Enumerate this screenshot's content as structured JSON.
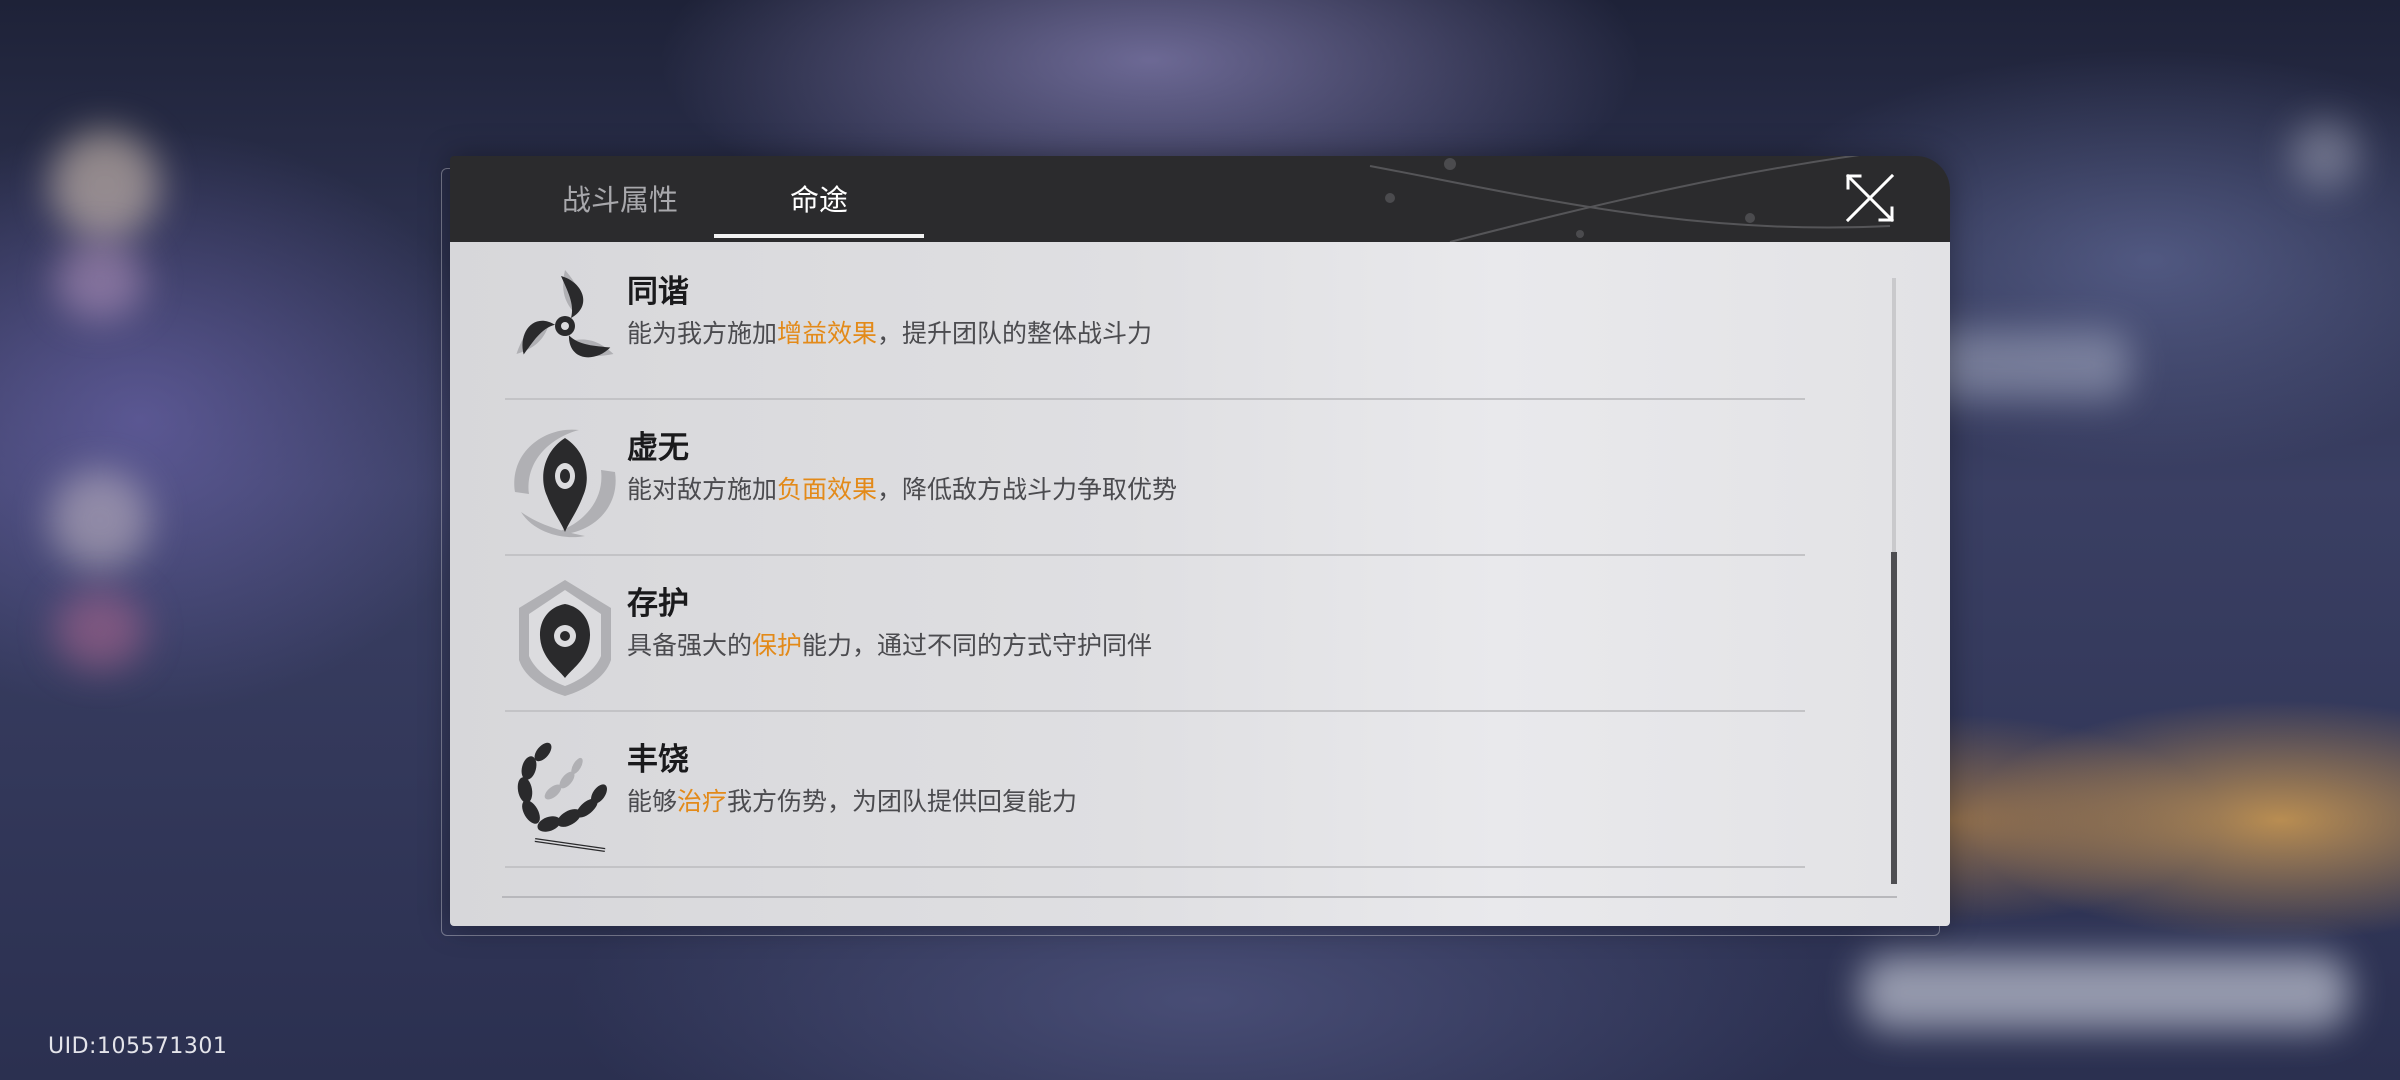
{
  "dialog": {
    "tabs": [
      {
        "label": "战斗属性",
        "active": false
      },
      {
        "label": "命途",
        "active": true
      }
    ],
    "close_icon": "close-x-icon"
  },
  "paths": [
    {
      "name": "同谐",
      "icon": "harmony-path-icon",
      "desc_before": "能为我方施加",
      "desc_highlight": "增益效果",
      "desc_after": "，提升团队的整体战斗力"
    },
    {
      "name": "虚无",
      "icon": "nihility-path-icon",
      "desc_before": "能对敌方施加",
      "desc_highlight": "负面效果",
      "desc_after": "，降低敌方战斗力争取优势"
    },
    {
      "name": "存护",
      "icon": "preservation-path-icon",
      "desc_before": "具备强大的",
      "desc_highlight": "保护",
      "desc_after": "能力，通过不同的方式守护同伴"
    },
    {
      "name": "丰饶",
      "icon": "abundance-path-icon",
      "desc_before": "能够",
      "desc_highlight": "治疗",
      "desc_after": "我方伤势，为团队提供回复能力"
    }
  ],
  "uid": "UID:105571301",
  "colors": {
    "highlight": "#e38a19",
    "header_bg": "#2b2b2d",
    "body_bg": "#dfdfe2"
  }
}
